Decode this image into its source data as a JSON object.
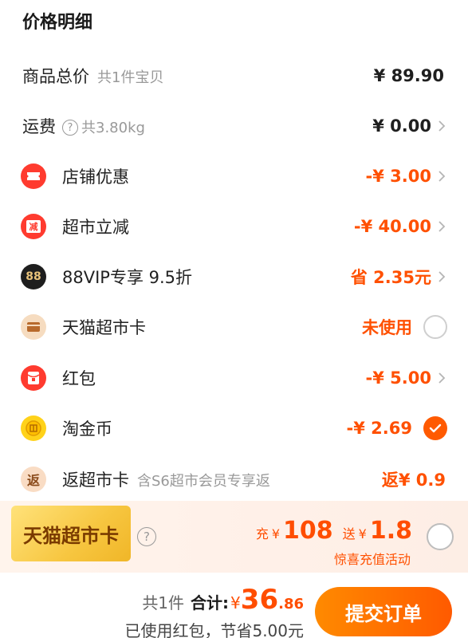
{
  "section_title": "价格明细",
  "rows": [
    {
      "label": "商品总价",
      "sub": "共1件宝贝",
      "value": "¥ 89.90"
    },
    {
      "label": "运费",
      "help": "?",
      "sub": "共3.80kg",
      "value": "¥ 0.00"
    },
    {
      "label": "店铺优惠",
      "value": "-¥ 3.00",
      "icon": "ticket-icon"
    },
    {
      "label": "超市立减",
      "value": "-¥ 40.00",
      "icon": "reduce-icon",
      "icon_text": "减"
    },
    {
      "label": "88VIP专享 9.5折",
      "value": "省 2.35元",
      "icon": "vip88-icon",
      "icon_text": "88"
    },
    {
      "label": "天猫超市卡",
      "value": "未使用",
      "icon": "card-icon"
    },
    {
      "label": "红包",
      "value": "-¥ 5.00",
      "icon": "red-envelope-icon"
    },
    {
      "label": "淘金币",
      "value": "-¥ 2.69",
      "icon": "gold-coin-icon"
    },
    {
      "label": "返超市卡",
      "sub": "含S6超市会员专享返",
      "value": "返¥ 0.9",
      "icon": "rebate-icon",
      "icon_text": "返"
    }
  ],
  "promo": {
    "card_label": "天猫超市卡",
    "help": "?",
    "charge_prefix": "充",
    "charge_currency": "¥",
    "charge_amount": "108",
    "gift_prefix": "送",
    "gift_currency": "¥",
    "gift_amount": "1.8",
    "note": "惊喜充值活动"
  },
  "footer": {
    "count": "共1件",
    "total_label": "合计:",
    "currency": "¥",
    "total_int": "36",
    "total_dec": ".86",
    "saved_text": "已使用红包，节省5.00元",
    "submit_label": "提交订单"
  },
  "colors": {
    "accent": "#ff5000",
    "button_start": "#ff8a00",
    "button_end": "#ff5a00"
  }
}
